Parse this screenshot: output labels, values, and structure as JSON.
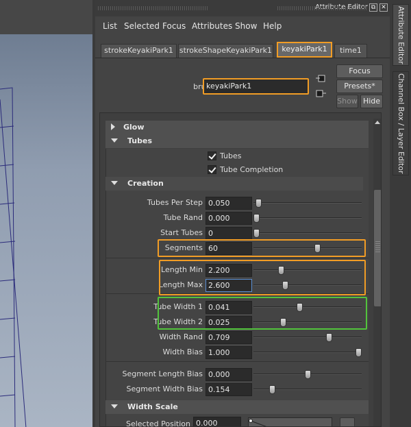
{
  "window": {
    "title": "Attribute Editor",
    "float_label": "⧉",
    "close_label": "✕"
  },
  "menu": [
    "List",
    "Selected",
    "Focus",
    "Attributes",
    "Show",
    "Help"
  ],
  "tabs": [
    "strokeKeyakiPark1",
    "strokeShapeKeyakiPark1",
    "keyakiPark1",
    "time1"
  ],
  "active_tab": "keyakiPark1",
  "brush": {
    "label": "brush:",
    "value": "keyakiPark1"
  },
  "buttons": {
    "focus": "Focus",
    "presets": "Presets*",
    "show": "Show",
    "hide": "Hide"
  },
  "sections": {
    "glow": "Glow",
    "tubes": "Tubes",
    "creation": "Creation",
    "width_scale": "Width Scale"
  },
  "checkboxes": {
    "tubes": "Tubes",
    "tube_completion": "Tube Completion"
  },
  "attrs": {
    "tubes_per_step": {
      "label": "Tubes Per Step",
      "value": "0.050",
      "slider": 0.02
    },
    "tube_rand": {
      "label": "Tube Rand",
      "value": "0.000",
      "slider": 0.0
    },
    "start_tubes": {
      "label": "Start Tubes",
      "value": "0",
      "slider": 0.0
    },
    "segments": {
      "label": "Segments",
      "value": "60",
      "slider": 0.6
    },
    "length_min": {
      "label": "Length Min",
      "value": "2.200",
      "slider": 0.24
    },
    "length_max": {
      "label": "Length Max",
      "value": "2.600",
      "slider": 0.28
    },
    "tube_width_1": {
      "label": "Tube Width 1",
      "value": "0.041",
      "slider": 0.42
    },
    "tube_width_2": {
      "label": "Tube Width 2",
      "value": "0.025",
      "slider": 0.26
    },
    "width_rand": {
      "label": "Width Rand",
      "value": "0.709",
      "slider": 0.709
    },
    "width_bias": {
      "label": "Width Bias",
      "value": "1.000",
      "slider": 1.0
    },
    "segment_length_bias": {
      "label": "Segment Length Bias",
      "value": "0.000",
      "slider": 0.5
    },
    "segment_width_bias": {
      "label": "Segment Width Bias",
      "value": "0.154",
      "slider": 0.154
    },
    "selected_position": {
      "label": "Selected Position",
      "value": "0.000"
    }
  },
  "side_tabs": [
    "Attribute Editor",
    "Channel Box / Layer Editor"
  ],
  "colors": {
    "orange_highlight": "#f29d25",
    "green_highlight": "#52c43c"
  }
}
